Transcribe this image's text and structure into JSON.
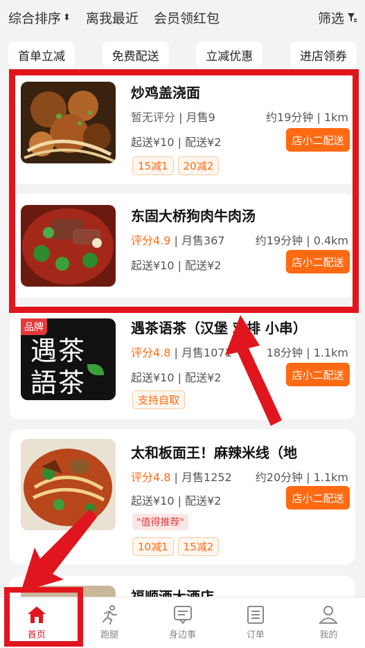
{
  "sort_bar": {
    "items": [
      "综合排序",
      "离我最近",
      "会员领红包"
    ],
    "filter_label": "筛选"
  },
  "chips": [
    "首单立减",
    "免费配送",
    "立减优惠",
    "进店领券"
  ],
  "stores": [
    {
      "name": "炒鸡盖浇面",
      "rating": "暂无评分",
      "sales": "月售9",
      "time_distance": "约19分钟 | 1km",
      "min_order": "起送¥10 | 配送¥2",
      "deliver_label": "店小二配送",
      "tags": [
        "15减1",
        "20减2"
      ],
      "thumb_icon": "braised-chicken-noodles-photo"
    },
    {
      "name": "东固大桥狗肉牛肉汤",
      "rating": "评分4.9",
      "sales": "月售367",
      "time_distance": "约19分钟 | 0.4km",
      "min_order": "起送¥10 | 配送¥2",
      "deliver_label": "店小二配送",
      "tags": [],
      "thumb_icon": "beef-soup-photo"
    },
    {
      "name": "遇茶语茶（汉堡 鸡排 小串）",
      "rating": "评分4.8",
      "sales": "月售1071",
      "time_distance": "18分钟 | 1.1km",
      "min_order": "起送¥10 | 配送¥2",
      "deliver_label": "店小二配送",
      "tags": [
        "支持自取"
      ],
      "brand_badge": "品牌",
      "logo_line1": "遇茶",
      "logo_line2": "語茶",
      "thumb_icon": "tea-brand-logo"
    },
    {
      "name": "太和板面王！麻辣米线（地",
      "rating": "评分4.8",
      "sales": "月售1252",
      "time_distance": "约20分钟 | 1.1km",
      "min_order": "起送¥10 | 配送¥2",
      "deliver_label": "店小二配送",
      "recommend": "\"值得推荐\"",
      "tags": [
        "10减1",
        "15减2"
      ],
      "thumb_icon": "spicy-noodle-photo"
    },
    {
      "name": "福顺酒大酒店",
      "thumb_icon": "restaurant-photo"
    }
  ],
  "nav": [
    {
      "label": "首页",
      "icon": "home-icon",
      "active": true
    },
    {
      "label": "跑腿",
      "icon": "runner-icon",
      "active": false
    },
    {
      "label": "身边事",
      "icon": "message-icon",
      "active": false
    },
    {
      "label": "订单",
      "icon": "order-list-icon",
      "active": false
    },
    {
      "label": "我的",
      "icon": "profile-icon",
      "active": false
    }
  ],
  "colors": {
    "accent": "#ff6a13",
    "highlight": "#e0151d",
    "background": "#f3f3f3"
  }
}
